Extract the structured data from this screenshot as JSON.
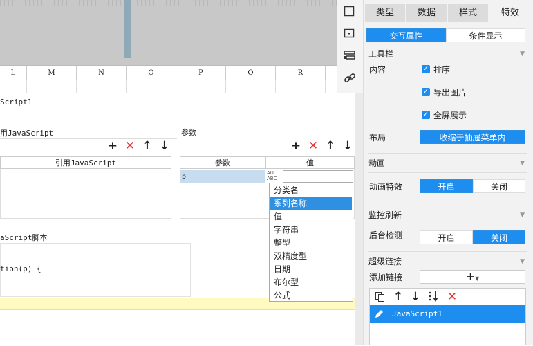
{
  "sheet": {
    "columns": [
      "L",
      "M",
      "N",
      "O",
      "P",
      "Q",
      "R"
    ]
  },
  "dialog": {
    "title": "Script1",
    "ref_section_title": "用JavaScript",
    "ref_table_header": "引用JavaScript",
    "param_section_title": "参数",
    "param_headers": {
      "name": "参数",
      "value": "值"
    },
    "param_rows": [
      {
        "name": "p",
        "value": ""
      }
    ],
    "script_section_title": "aScript脚本",
    "script_code": "tion(p) {",
    "toolbar": {
      "add": "+",
      "delete": "✕",
      "up": "↑",
      "down": "↓"
    }
  },
  "type_dropdown": {
    "icon_text": "AU ABC",
    "items": [
      "分类名",
      "系列名称",
      "值",
      "字符串",
      "整型",
      "双精度型",
      "日期",
      "布尔型",
      "公式"
    ],
    "selected": "系列名称"
  },
  "tool_strip": {
    "icons": [
      "square-icon",
      "dropdown-box-icon",
      "widget-list-icon",
      "link-icon"
    ]
  },
  "right_panel": {
    "tabs": [
      "类型",
      "数据",
      "样式",
      "特效"
    ],
    "active_tab": "特效",
    "subtabs": [
      "交互属性",
      "条件显示"
    ],
    "active_subtab": "交互属性",
    "toolbar_section": {
      "title": "工具栏",
      "content_label": "内容",
      "options": [
        "排序",
        "导出图片",
        "全屏展示"
      ],
      "layout_label": "布局",
      "layout_value": "收缩于抽屉菜单内"
    },
    "animation_section": {
      "title": "动画",
      "effect_label": "动画特效",
      "on": "开启",
      "off": "关闭",
      "selected": "开启"
    },
    "monitor_section": {
      "title": "监控刷新",
      "bg_label": "后台检测",
      "on": "开启",
      "off": "关闭",
      "selected": "关闭"
    },
    "hyperlink_section": {
      "title": "超级链接",
      "add_label": "添加链接",
      "add_button": "+",
      "links": [
        "JavaScript1"
      ]
    }
  },
  "colors": {
    "accent": "#1e8df0",
    "panel_bg": "#f2f2f2",
    "delete_red": "#e03030",
    "highlight_row": "#c7dcee"
  }
}
